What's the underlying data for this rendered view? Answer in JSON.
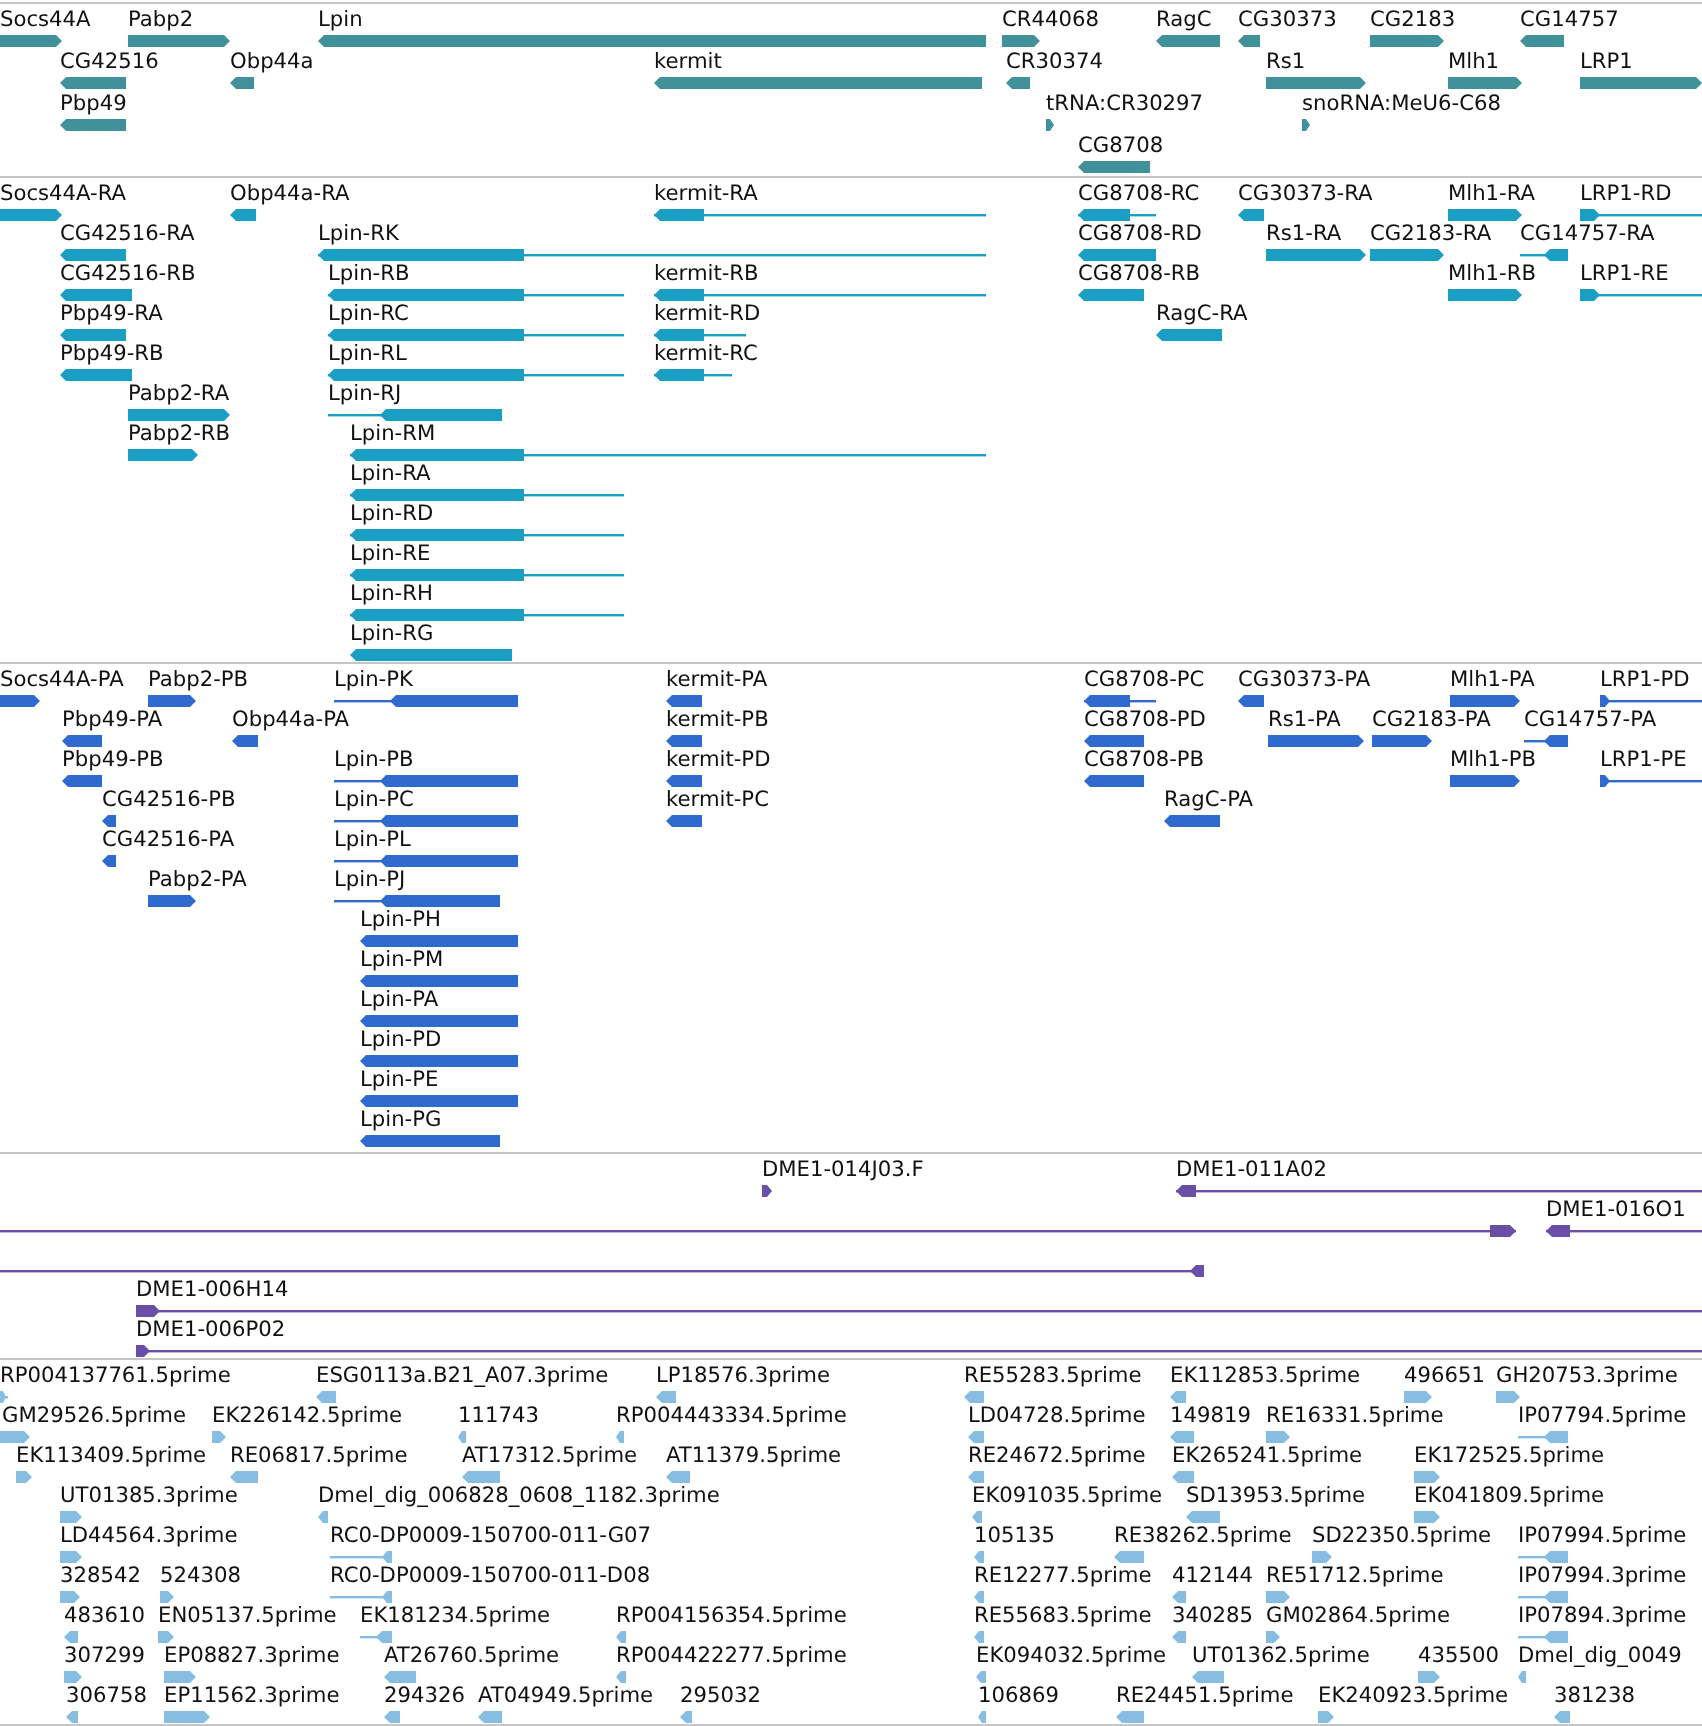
{
  "tracks": [
    {
      "color": "#41919a",
      "features": [
        {
          "label": "Socs44A",
          "reverse": false
        },
        {
          "label": "Pabp2",
          "reverse": false
        },
        {
          "label": "Lpin",
          "reverse": true
        },
        {
          "label": "CR44068",
          "reverse": false
        },
        {
          "label": "RagC",
          "reverse": true
        },
        {
          "label": "CG30373",
          "reverse": true
        },
        {
          "label": "CG2183",
          "reverse": false
        },
        {
          "label": "CG14757",
          "reverse": true
        },
        {
          "label": "CG42516",
          "reverse": true
        },
        {
          "label": "Obp44a",
          "reverse": true
        },
        {
          "label": "kermit",
          "reverse": true
        },
        {
          "label": "CR30374",
          "reverse": true
        },
        {
          "label": "Rs1",
          "reverse": false
        },
        {
          "label": "Mlh1",
          "reverse": false
        },
        {
          "label": "LRP1",
          "reverse": false
        },
        {
          "label": "Pbp49",
          "reverse": true
        },
        {
          "label": "tRNA:CR30297",
          "reverse": false
        },
        {
          "label": "snoRNA:MeU6-C68",
          "reverse": false
        },
        {
          "label": "CG8708",
          "reverse": true
        }
      ]
    },
    {
      "color": "#1a9ec4",
      "features": [
        {
          "label": "Socs44A-RA",
          "reverse": false
        },
        {
          "label": "Obp44a-RA",
          "reverse": true
        },
        {
          "label": "kermit-RA",
          "reverse": true
        },
        {
          "label": "CG8708-RC",
          "reverse": true
        },
        {
          "label": "CG30373-RA",
          "reverse": true
        },
        {
          "label": "Mlh1-RA",
          "reverse": false
        },
        {
          "label": "LRP1-RD",
          "reverse": false
        },
        {
          "label": "CG42516-RA",
          "reverse": true
        },
        {
          "label": "Lpin-RK",
          "reverse": true
        },
        {
          "label": "CG8708-RD",
          "reverse": true
        },
        {
          "label": "Rs1-RA",
          "reverse": false
        },
        {
          "label": "CG2183-RA",
          "reverse": false
        },
        {
          "label": "CG14757-RA",
          "reverse": true
        },
        {
          "label": "CG42516-RB",
          "reverse": true
        },
        {
          "label": "Lpin-RB",
          "reverse": true
        },
        {
          "label": "kermit-RB",
          "reverse": true
        },
        {
          "label": "CG8708-RB",
          "reverse": true
        },
        {
          "label": "Mlh1-RB",
          "reverse": false
        },
        {
          "label": "LRP1-RE",
          "reverse": false
        },
        {
          "label": "Pbp49-RA",
          "reverse": true
        },
        {
          "label": "Lpin-RC",
          "reverse": true
        },
        {
          "label": "kermit-RD",
          "reverse": true
        },
        {
          "label": "RagC-RA",
          "reverse": true
        },
        {
          "label": "Pbp49-RB",
          "reverse": true
        },
        {
          "label": "Lpin-RL",
          "reverse": true
        },
        {
          "label": "kermit-RC",
          "reverse": true
        },
        {
          "label": "Pabp2-RA",
          "reverse": false
        },
        {
          "label": "Lpin-RJ",
          "reverse": true
        },
        {
          "label": "Pabp2-RB",
          "reverse": false
        },
        {
          "label": "Lpin-RM",
          "reverse": true
        },
        {
          "label": "Lpin-RA",
          "reverse": true
        },
        {
          "label": "Lpin-RD",
          "reverse": true
        },
        {
          "label": "Lpin-RE",
          "reverse": true
        },
        {
          "label": "Lpin-RH",
          "reverse": true
        },
        {
          "label": "Lpin-RG",
          "reverse": true
        }
      ]
    },
    {
      "color": "#2f6bcf",
      "features": [
        {
          "label": "Socs44A-PA",
          "reverse": false
        },
        {
          "label": "Pabp2-PB",
          "reverse": false
        },
        {
          "label": "Lpin-PK",
          "reverse": true
        },
        {
          "label": "kermit-PA",
          "reverse": true
        },
        {
          "label": "CG8708-PC",
          "reverse": true
        },
        {
          "label": "CG30373-PA",
          "reverse": true
        },
        {
          "label": "Mlh1-PA",
          "reverse": false
        },
        {
          "label": "LRP1-PD",
          "reverse": false
        },
        {
          "label": "Pbp49-PA",
          "reverse": true
        },
        {
          "label": "Obp44a-PA",
          "reverse": true
        },
        {
          "label": "kermit-PB",
          "reverse": true
        },
        {
          "label": "CG8708-PD",
          "reverse": true
        },
        {
          "label": "Rs1-PA",
          "reverse": false
        },
        {
          "label": "CG2183-PA",
          "reverse": false
        },
        {
          "label": "CG14757-PA",
          "reverse": true
        },
        {
          "label": "Pbp49-PB",
          "reverse": true
        },
        {
          "label": "Lpin-PB",
          "reverse": true
        },
        {
          "label": "kermit-PD",
          "reverse": true
        },
        {
          "label": "CG8708-PB",
          "reverse": true
        },
        {
          "label": "Mlh1-PB",
          "reverse": false
        },
        {
          "label": "LRP1-PE",
          "reverse": false
        },
        {
          "label": "CG42516-PB",
          "reverse": true
        },
        {
          "label": "Lpin-PC",
          "reverse": true
        },
        {
          "label": "kermit-PC",
          "reverse": true
        },
        {
          "label": "RagC-PA",
          "reverse": true
        },
        {
          "label": "CG42516-PA",
          "reverse": true
        },
        {
          "label": "Lpin-PL",
          "reverse": true
        },
        {
          "label": "Pabp2-PA",
          "reverse": false
        },
        {
          "label": "Lpin-PJ",
          "reverse": true
        },
        {
          "label": "Lpin-PH",
          "reverse": true
        },
        {
          "label": "Lpin-PM",
          "reverse": true
        },
        {
          "label": "Lpin-PA",
          "reverse": true
        },
        {
          "label": "Lpin-PD",
          "reverse": true
        },
        {
          "label": "Lpin-PE",
          "reverse": true
        },
        {
          "label": "Lpin-PG",
          "reverse": true
        }
      ]
    },
    {
      "color": "#6b4fa6",
      "features": [
        {
          "label": "DME1-014J03.F",
          "reverse": false
        },
        {
          "label": "DME1-011A02",
          "reverse": true
        },
        {
          "reverse": false
        },
        {
          "label": "DME1-016O1",
          "reverse": true
        },
        {
          "reverse": true
        },
        {
          "label": "DME1-006H14",
          "reverse": false
        },
        {
          "label": "DME1-006P02",
          "reverse": false
        }
      ]
    },
    {
      "color": "#88bde2",
      "features": [
        {
          "label": "RP004137761.5prime",
          "reverse": false
        },
        {
          "label": "ESG0113a.B21_A07.3prime",
          "reverse": true
        },
        {
          "label": "LP18576.3prime",
          "reverse": true
        },
        {
          "label": "RE55283.5prime",
          "reverse": true
        },
        {
          "label": "EK112853.5prime",
          "reverse": true
        },
        {
          "label": "496651",
          "reverse": false
        },
        {
          "label": "GH20753.3prime",
          "reverse": false
        },
        {
          "label": "GM29526.5prime",
          "reverse": false
        },
        {
          "label": "EK226142.5prime",
          "reverse": false
        },
        {
          "label": "111743",
          "reverse": true
        },
        {
          "label": "RP004443334.5prime",
          "reverse": true
        },
        {
          "label": "LD04728.5prime",
          "reverse": true
        },
        {
          "label": "149819",
          "reverse": true
        },
        {
          "label": "RE16331.5prime",
          "reverse": false
        },
        {
          "label": "IP07794.5prime",
          "reverse": true
        },
        {
          "label": "EK113409.5prime",
          "reverse": false
        },
        {
          "label": "RE06817.5prime",
          "reverse": true
        },
        {
          "label": "AT17312.5prime",
          "reverse": true
        },
        {
          "label": "AT11379.5prime",
          "reverse": true
        },
        {
          "label": "RE24672.5prime",
          "reverse": true
        },
        {
          "label": "EK265241.5prime",
          "reverse": true
        },
        {
          "label": "EK172525.5prime",
          "reverse": false
        },
        {
          "label": "UT01385.3prime",
          "reverse": false
        },
        {
          "label": "Dmel_dig_006828_0608_1182.3prime",
          "reverse": true
        },
        {
          "label": "EK091035.5prime",
          "reverse": true
        },
        {
          "label": "SD13953.5prime",
          "reverse": true
        },
        {
          "label": "EK041809.5prime",
          "reverse": false
        },
        {
          "label": "LD44564.3prime",
          "reverse": false
        },
        {
          "label": "RC0-DP0009-150700-011-G07",
          "reverse": true
        },
        {
          "label": "105135",
          "reverse": true
        },
        {
          "label": "RE38262.5prime",
          "reverse": true
        },
        {
          "label": "SD22350.5prime",
          "reverse": false
        },
        {
          "label": "IP07994.5prime",
          "reverse": true
        },
        {
          "label": "328542",
          "reverse": false
        },
        {
          "label": "524308",
          "reverse": false
        },
        {
          "label": "RC0-DP0009-150700-011-D08",
          "reverse": true
        },
        {
          "label": "RE12277.5prime",
          "reverse": true
        },
        {
          "label": "412144",
          "reverse": true
        },
        {
          "label": "RE51712.5prime",
          "reverse": false
        },
        {
          "label": "IP07994.3prime",
          "reverse": true
        },
        {
          "label": "483610",
          "reverse": true
        },
        {
          "label": "EN05137.5prime",
          "reverse": false
        },
        {
          "label": "EK181234.5prime",
          "reverse": true
        },
        {
          "label": "RP004156354.5prime",
          "reverse": true
        },
        {
          "label": "RE55683.5prime",
          "reverse": true
        },
        {
          "label": "340285",
          "reverse": true
        },
        {
          "label": "GM02864.5prime",
          "reverse": false
        },
        {
          "label": "IP07894.3prime",
          "reverse": true
        },
        {
          "label": "307299",
          "reverse": false
        },
        {
          "label": "EP08827.3prime",
          "reverse": false
        },
        {
          "label": "AT26760.5prime",
          "reverse": true
        },
        {
          "label": "RP004422277.5prime",
          "reverse": true
        },
        {
          "label": "EK094032.5prime",
          "reverse": true
        },
        {
          "label": "UT01362.5prime",
          "reverse": true
        },
        {
          "label": "435500",
          "reverse": false
        },
        {
          "label": "Dmel_dig_0049",
          "reverse": true
        },
        {
          "label": "306758",
          "reverse": true
        },
        {
          "label": "EP11562.3prime",
          "reverse": false
        },
        {
          "label": "294326",
          "reverse": true
        },
        {
          "label": "AT04949.5prime",
          "reverse": true
        },
        {
          "label": "295032",
          "reverse": true
        },
        {
          "label": "106869",
          "reverse": true
        },
        {
          "label": "RE24451.5prime",
          "reverse": true
        },
        {
          "label": "EK240923.5prime",
          "reverse": false
        },
        {
          "label": "381238",
          "reverse": true
        }
      ]
    }
  ]
}
